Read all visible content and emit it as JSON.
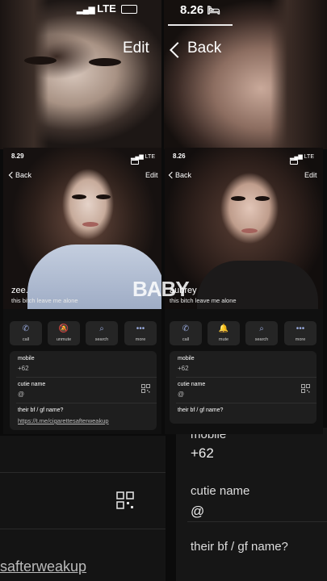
{
  "background": {
    "status_left": "LTE",
    "status_right": "8.26",
    "edit_label": "Edit",
    "back_label": "Back",
    "mobile_label": "mobile",
    "mobile_value": "+62",
    "cutie_label": "cutie name",
    "cutie_value": "@",
    "bfgf_label": "their bf / gf name?",
    "link_fragment": "safterweakup"
  },
  "overlay_text": "BABY",
  "cards": [
    {
      "time": "8.29",
      "status": "LTE",
      "back_label": "Back",
      "edit_label": "Edit",
      "name": "zee.",
      "status_line": "this bitch leave me alone",
      "actions": [
        {
          "label": "call",
          "icon": "phone-icon"
        },
        {
          "label": "unmute",
          "icon": "bell-slash-icon"
        },
        {
          "label": "search",
          "icon": "search-icon"
        },
        {
          "label": "more",
          "icon": "more-icon"
        }
      ],
      "mobile_label": "mobile",
      "mobile_value": "+62",
      "cutie_label": "cutie name",
      "cutie_value": "@",
      "bfgf_label": "their bf / gf name?",
      "bfgf_value": "https://t.me/cigarettesafterweakup"
    },
    {
      "time": "8.26",
      "status": "LTE",
      "back_label": "Back",
      "edit_label": "Edit",
      "name": "aubrey",
      "status_line": "this bitch leave me alone",
      "actions": [
        {
          "label": "call",
          "icon": "phone-icon"
        },
        {
          "label": "mute",
          "icon": "bell-icon"
        },
        {
          "label": "search",
          "icon": "search-icon"
        },
        {
          "label": "more",
          "icon": "more-icon"
        }
      ],
      "mobile_label": "mobile",
      "mobile_value": "+62",
      "cutie_label": "cutie name",
      "cutie_value": "@",
      "bfgf_label": "their bf / gf name?",
      "bfgf_value": ""
    }
  ]
}
